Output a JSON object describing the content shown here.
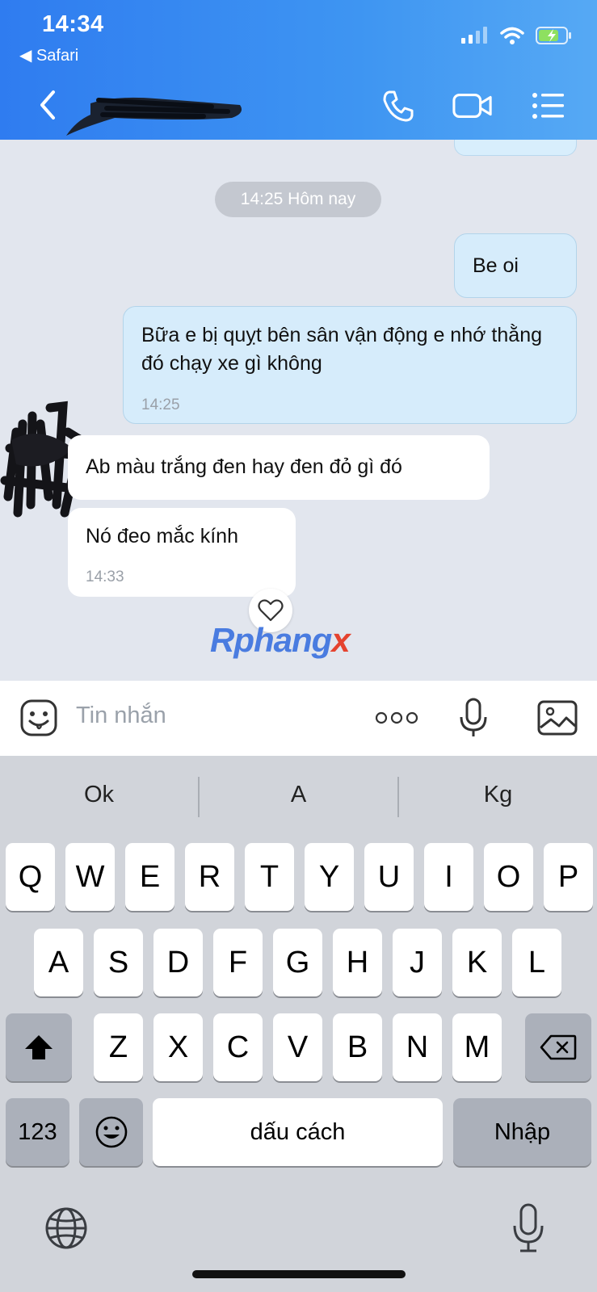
{
  "status_bar": {
    "time": "14:34",
    "back_app": "◀ Safari"
  },
  "chat": {
    "date_separator": "14:25 Hôm nay",
    "messages": [
      {
        "dir": "out",
        "text": "Be oi",
        "time": ""
      },
      {
        "dir": "out",
        "text": "Bữa e bị quỵt bên sân vận động e nhớ thằng đó chạy xe gì không",
        "time": "14:25"
      },
      {
        "dir": "in",
        "text": "Ab màu trắng đen hay đen đỏ gì đó",
        "time": ""
      },
      {
        "dir": "in",
        "text": "Nó đeo mắc kính",
        "time": "14:33"
      }
    ],
    "watermark_main": "Rphang",
    "watermark_last": "x"
  },
  "input": {
    "placeholder": "Tin nhắn"
  },
  "keyboard": {
    "suggestions": [
      "Ok",
      "A",
      "Kg"
    ],
    "row1": [
      "Q",
      "W",
      "E",
      "R",
      "T",
      "Y",
      "U",
      "I",
      "O",
      "P"
    ],
    "row2": [
      "A",
      "S",
      "D",
      "F",
      "G",
      "H",
      "J",
      "K",
      "L"
    ],
    "row3": [
      "Z",
      "X",
      "C",
      "V",
      "B",
      "N",
      "M"
    ],
    "numbers_key": "123",
    "space_key": "dấu cách",
    "return_key": "Nhập"
  },
  "colors": {
    "header_start": "#2f7cf0",
    "header_end": "#56a9f4",
    "outgoing_bubble": "#d6ecfb",
    "incoming_bubble": "#ffffff"
  }
}
